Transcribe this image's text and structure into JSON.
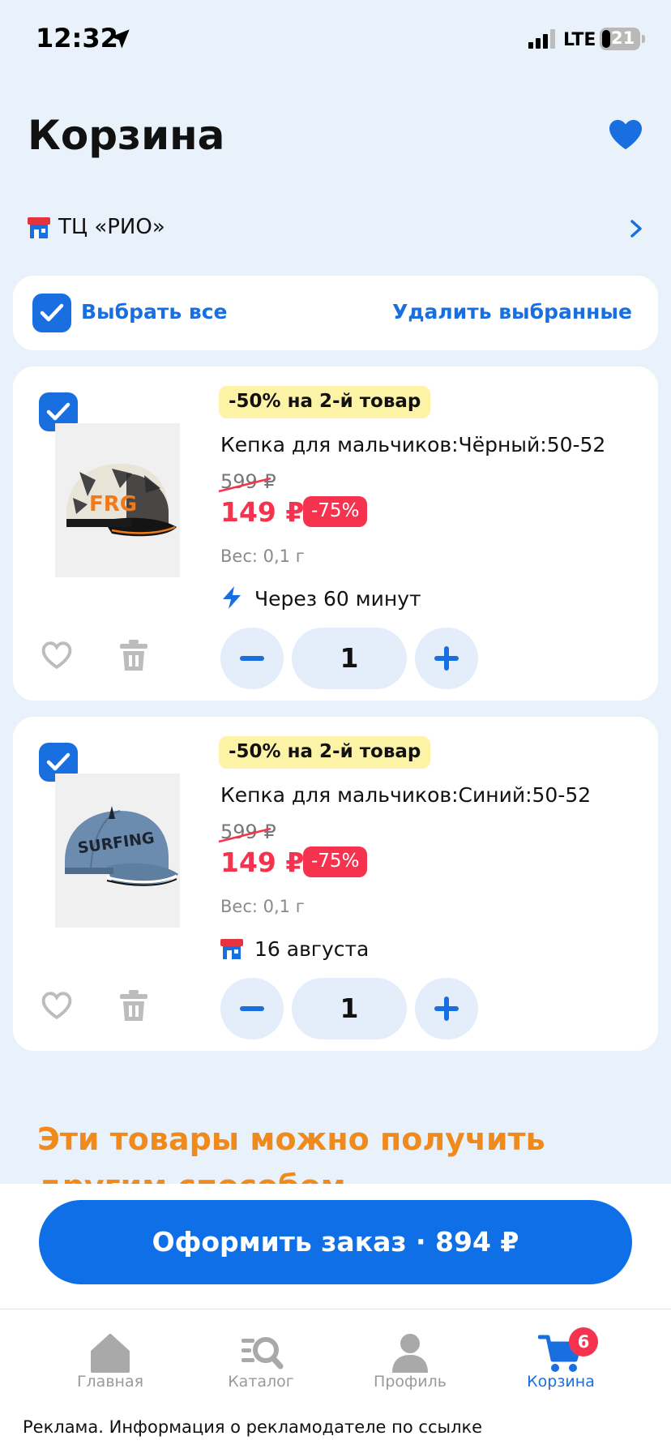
{
  "status_bar": {
    "time": "12:32",
    "network": "LTE",
    "battery": "21"
  },
  "header": {
    "title": "Корзина"
  },
  "store": {
    "name": "ТЦ «РИО»"
  },
  "selection": {
    "select_all": "Выбрать все",
    "delete_selected": "Удалить выбранные"
  },
  "items": [
    {
      "promo": "-50% на 2-й товар",
      "name": "Кепка для мальчиков:Чёрный:50-52",
      "old_price": "599 ₽",
      "price": "149 ₽",
      "discount": "-75%",
      "weight": "Вес: 0,1 г",
      "delivery": "Через 60 минут",
      "delivery_icon": "lightning-icon",
      "quantity": "1"
    },
    {
      "promo": "-50% на 2-й товар",
      "name": "Кепка для мальчиков:Синий:50-52",
      "old_price": "599 ₽",
      "price": "149 ₽",
      "discount": "-75%",
      "weight": "Вес: 0,1 г",
      "delivery": "16 августа",
      "delivery_icon": "store-icon",
      "quantity": "1"
    }
  ],
  "alternative": {
    "heading": "Эти товары можно получить другим способом"
  },
  "checkout": {
    "label": "Оформить заказ · 894 ₽"
  },
  "tabs": [
    {
      "label": "Главная",
      "icon": "home-icon"
    },
    {
      "label": "Каталог",
      "icon": "catalog-search-icon"
    },
    {
      "label": "Профиль",
      "icon": "profile-icon"
    },
    {
      "label": "Корзина",
      "icon": "cart-icon",
      "badge": "6",
      "active": true
    }
  ],
  "ad": {
    "text": "Реклама. Информация о рекламодателе по ссылке"
  },
  "colors": {
    "accent": "#1a6fe0",
    "price_red": "#f5334f",
    "promo_yellow": "#fdf3a6",
    "heading_orange": "#f08a1c",
    "background": "#e9f2fb"
  }
}
